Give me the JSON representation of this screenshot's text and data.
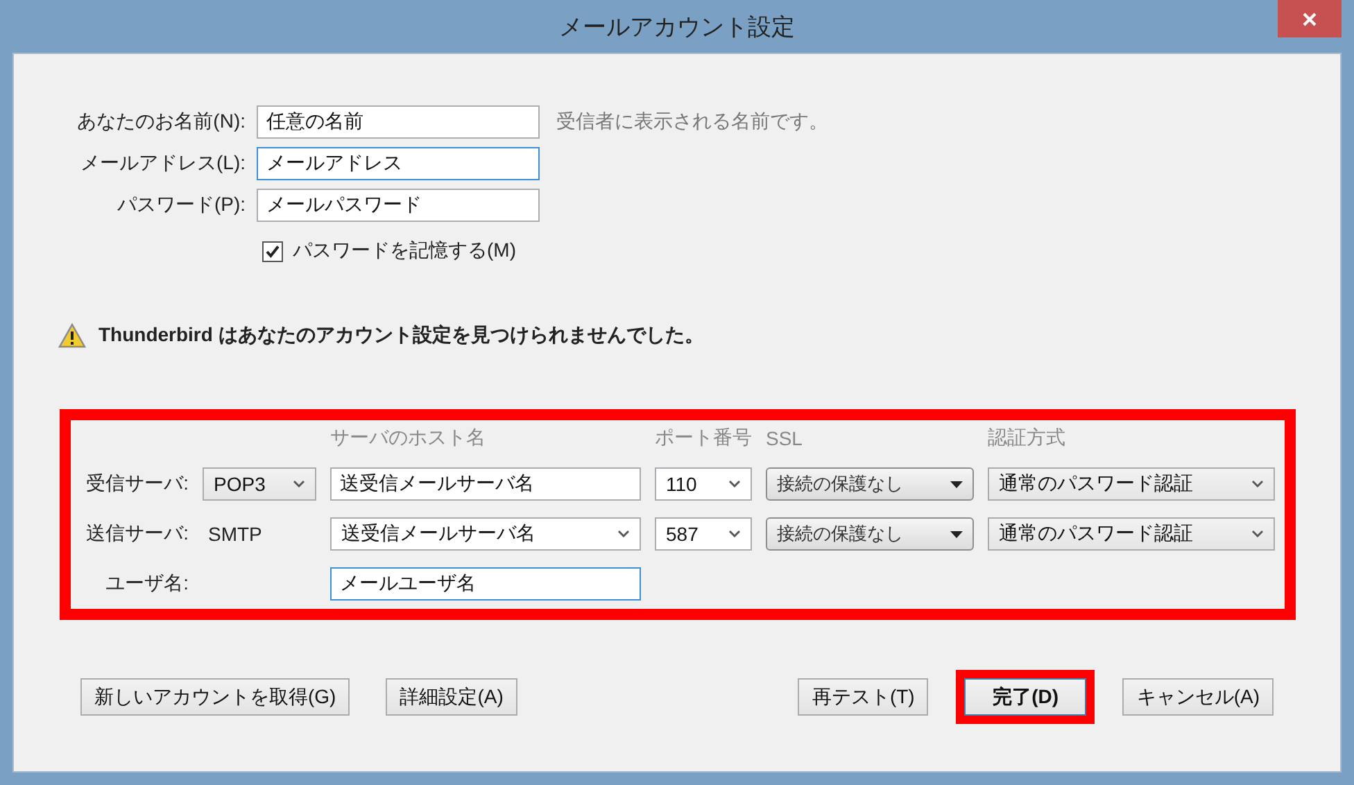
{
  "window": {
    "title": "メールアカウント設定"
  },
  "account": {
    "fields": [
      {
        "label": "あなたのお名前(N):",
        "value": "任意の名前",
        "focused": false,
        "hint": "受信者に表示される名前です。"
      },
      {
        "label": "メールアドレス(L):",
        "value": "メールアドレス",
        "focused": true
      },
      {
        "label": "パスワード(P):",
        "value": "メールパスワード",
        "focused": false
      }
    ],
    "remember_password": {
      "label": "パスワードを記憶する(M)",
      "checked": true
    }
  },
  "warning": "Thunderbird はあなたのアカウント設定を見つけられませんでした。",
  "server": {
    "highlighted": true,
    "columns": [
      "サーバのホスト名",
      "ポート番号",
      "SSL",
      "認証方式"
    ],
    "rows": [
      {
        "label": "受信サーバ:",
        "protocol": {
          "kind": "select",
          "value": "POP3"
        },
        "host": {
          "kind": "input",
          "value": "送受信メールサーバ名"
        },
        "port": "110",
        "ssl": "接続の保護なし",
        "auth": "通常のパスワード認証"
      },
      {
        "label": "送信サーバ:",
        "protocol": {
          "kind": "text",
          "value": "SMTP"
        },
        "host": {
          "kind": "select",
          "value": "送受信メールサーバ名"
        },
        "port": "587",
        "ssl": "接続の保護なし",
        "auth": "通常のパスワード認証"
      }
    ],
    "username": {
      "label": "ユーザ名:",
      "value": "メールユーザ名",
      "focused": true
    }
  },
  "buttons_left": [
    {
      "label": "新しいアカウントを取得(G)",
      "default": false,
      "highlighted": false
    },
    {
      "label": "詳細設定(A)",
      "default": false,
      "highlighted": false
    }
  ],
  "buttons_right": [
    {
      "label": "再テスト(T)",
      "default": false,
      "highlighted": false
    },
    {
      "label": "完了(D)",
      "default": true,
      "highlighted": true
    },
    {
      "label": "キャンセル(A)",
      "default": false,
      "highlighted": false
    }
  ]
}
